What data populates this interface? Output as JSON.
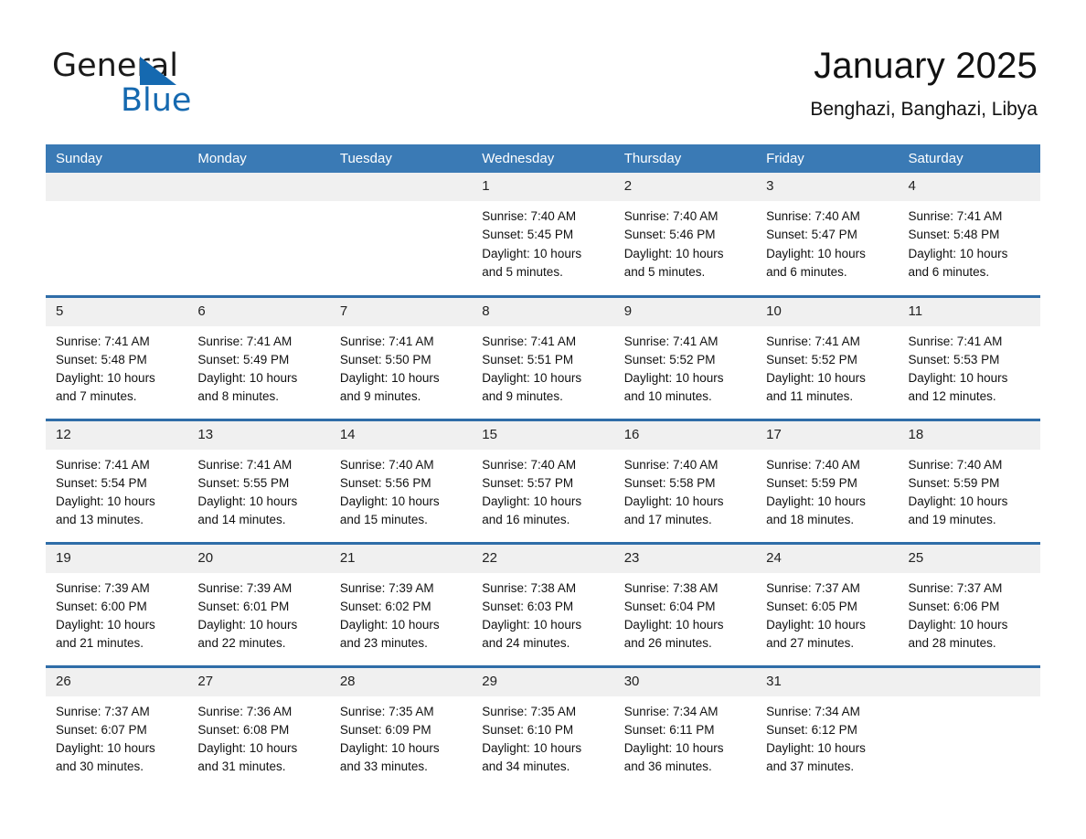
{
  "brand": {
    "name_part1": "General",
    "name_part2": "Blue",
    "accent_color": "#1569b0",
    "triangle_icon": "triangle-icon"
  },
  "header": {
    "title": "January 2025",
    "subtitle": "Benghazi, Banghazi, Libya"
  },
  "theme": {
    "header_row_bg": "#3a7ab5",
    "row_divider": "#2f6da8",
    "date_band_bg": "#f0f0f0",
    "text": "#111111"
  },
  "weekdays": [
    "Sunday",
    "Monday",
    "Tuesday",
    "Wednesday",
    "Thursday",
    "Friday",
    "Saturday"
  ],
  "weeks": [
    [
      {
        "date": "",
        "info": ""
      },
      {
        "date": "",
        "info": ""
      },
      {
        "date": "",
        "info": ""
      },
      {
        "date": "1",
        "info": "Sunrise: 7:40 AM\nSunset: 5:45 PM\nDaylight: 10 hours\nand 5 minutes."
      },
      {
        "date": "2",
        "info": "Sunrise: 7:40 AM\nSunset: 5:46 PM\nDaylight: 10 hours\nand 5 minutes."
      },
      {
        "date": "3",
        "info": "Sunrise: 7:40 AM\nSunset: 5:47 PM\nDaylight: 10 hours\nand 6 minutes."
      },
      {
        "date": "4",
        "info": "Sunrise: 7:41 AM\nSunset: 5:48 PM\nDaylight: 10 hours\nand 6 minutes."
      }
    ],
    [
      {
        "date": "5",
        "info": "Sunrise: 7:41 AM\nSunset: 5:48 PM\nDaylight: 10 hours\nand 7 minutes."
      },
      {
        "date": "6",
        "info": "Sunrise: 7:41 AM\nSunset: 5:49 PM\nDaylight: 10 hours\nand 8 minutes."
      },
      {
        "date": "7",
        "info": "Sunrise: 7:41 AM\nSunset: 5:50 PM\nDaylight: 10 hours\nand 9 minutes."
      },
      {
        "date": "8",
        "info": "Sunrise: 7:41 AM\nSunset: 5:51 PM\nDaylight: 10 hours\nand 9 minutes."
      },
      {
        "date": "9",
        "info": "Sunrise: 7:41 AM\nSunset: 5:52 PM\nDaylight: 10 hours\nand 10 minutes."
      },
      {
        "date": "10",
        "info": "Sunrise: 7:41 AM\nSunset: 5:52 PM\nDaylight: 10 hours\nand 11 minutes."
      },
      {
        "date": "11",
        "info": "Sunrise: 7:41 AM\nSunset: 5:53 PM\nDaylight: 10 hours\nand 12 minutes."
      }
    ],
    [
      {
        "date": "12",
        "info": "Sunrise: 7:41 AM\nSunset: 5:54 PM\nDaylight: 10 hours\nand 13 minutes."
      },
      {
        "date": "13",
        "info": "Sunrise: 7:41 AM\nSunset: 5:55 PM\nDaylight: 10 hours\nand 14 minutes."
      },
      {
        "date": "14",
        "info": "Sunrise: 7:40 AM\nSunset: 5:56 PM\nDaylight: 10 hours\nand 15 minutes."
      },
      {
        "date": "15",
        "info": "Sunrise: 7:40 AM\nSunset: 5:57 PM\nDaylight: 10 hours\nand 16 minutes."
      },
      {
        "date": "16",
        "info": "Sunrise: 7:40 AM\nSunset: 5:58 PM\nDaylight: 10 hours\nand 17 minutes."
      },
      {
        "date": "17",
        "info": "Sunrise: 7:40 AM\nSunset: 5:59 PM\nDaylight: 10 hours\nand 18 minutes."
      },
      {
        "date": "18",
        "info": "Sunrise: 7:40 AM\nSunset: 5:59 PM\nDaylight: 10 hours\nand 19 minutes."
      }
    ],
    [
      {
        "date": "19",
        "info": "Sunrise: 7:39 AM\nSunset: 6:00 PM\nDaylight: 10 hours\nand 21 minutes."
      },
      {
        "date": "20",
        "info": "Sunrise: 7:39 AM\nSunset: 6:01 PM\nDaylight: 10 hours\nand 22 minutes."
      },
      {
        "date": "21",
        "info": "Sunrise: 7:39 AM\nSunset: 6:02 PM\nDaylight: 10 hours\nand 23 minutes."
      },
      {
        "date": "22",
        "info": "Sunrise: 7:38 AM\nSunset: 6:03 PM\nDaylight: 10 hours\nand 24 minutes."
      },
      {
        "date": "23",
        "info": "Sunrise: 7:38 AM\nSunset: 6:04 PM\nDaylight: 10 hours\nand 26 minutes."
      },
      {
        "date": "24",
        "info": "Sunrise: 7:37 AM\nSunset: 6:05 PM\nDaylight: 10 hours\nand 27 minutes."
      },
      {
        "date": "25",
        "info": "Sunrise: 7:37 AM\nSunset: 6:06 PM\nDaylight: 10 hours\nand 28 minutes."
      }
    ],
    [
      {
        "date": "26",
        "info": "Sunrise: 7:37 AM\nSunset: 6:07 PM\nDaylight: 10 hours\nand 30 minutes."
      },
      {
        "date": "27",
        "info": "Sunrise: 7:36 AM\nSunset: 6:08 PM\nDaylight: 10 hours\nand 31 minutes."
      },
      {
        "date": "28",
        "info": "Sunrise: 7:35 AM\nSunset: 6:09 PM\nDaylight: 10 hours\nand 33 minutes."
      },
      {
        "date": "29",
        "info": "Sunrise: 7:35 AM\nSunset: 6:10 PM\nDaylight: 10 hours\nand 34 minutes."
      },
      {
        "date": "30",
        "info": "Sunrise: 7:34 AM\nSunset: 6:11 PM\nDaylight: 10 hours\nand 36 minutes."
      },
      {
        "date": "31",
        "info": "Sunrise: 7:34 AM\nSunset: 6:12 PM\nDaylight: 10 hours\nand 37 minutes."
      },
      {
        "date": "",
        "info": ""
      }
    ]
  ]
}
